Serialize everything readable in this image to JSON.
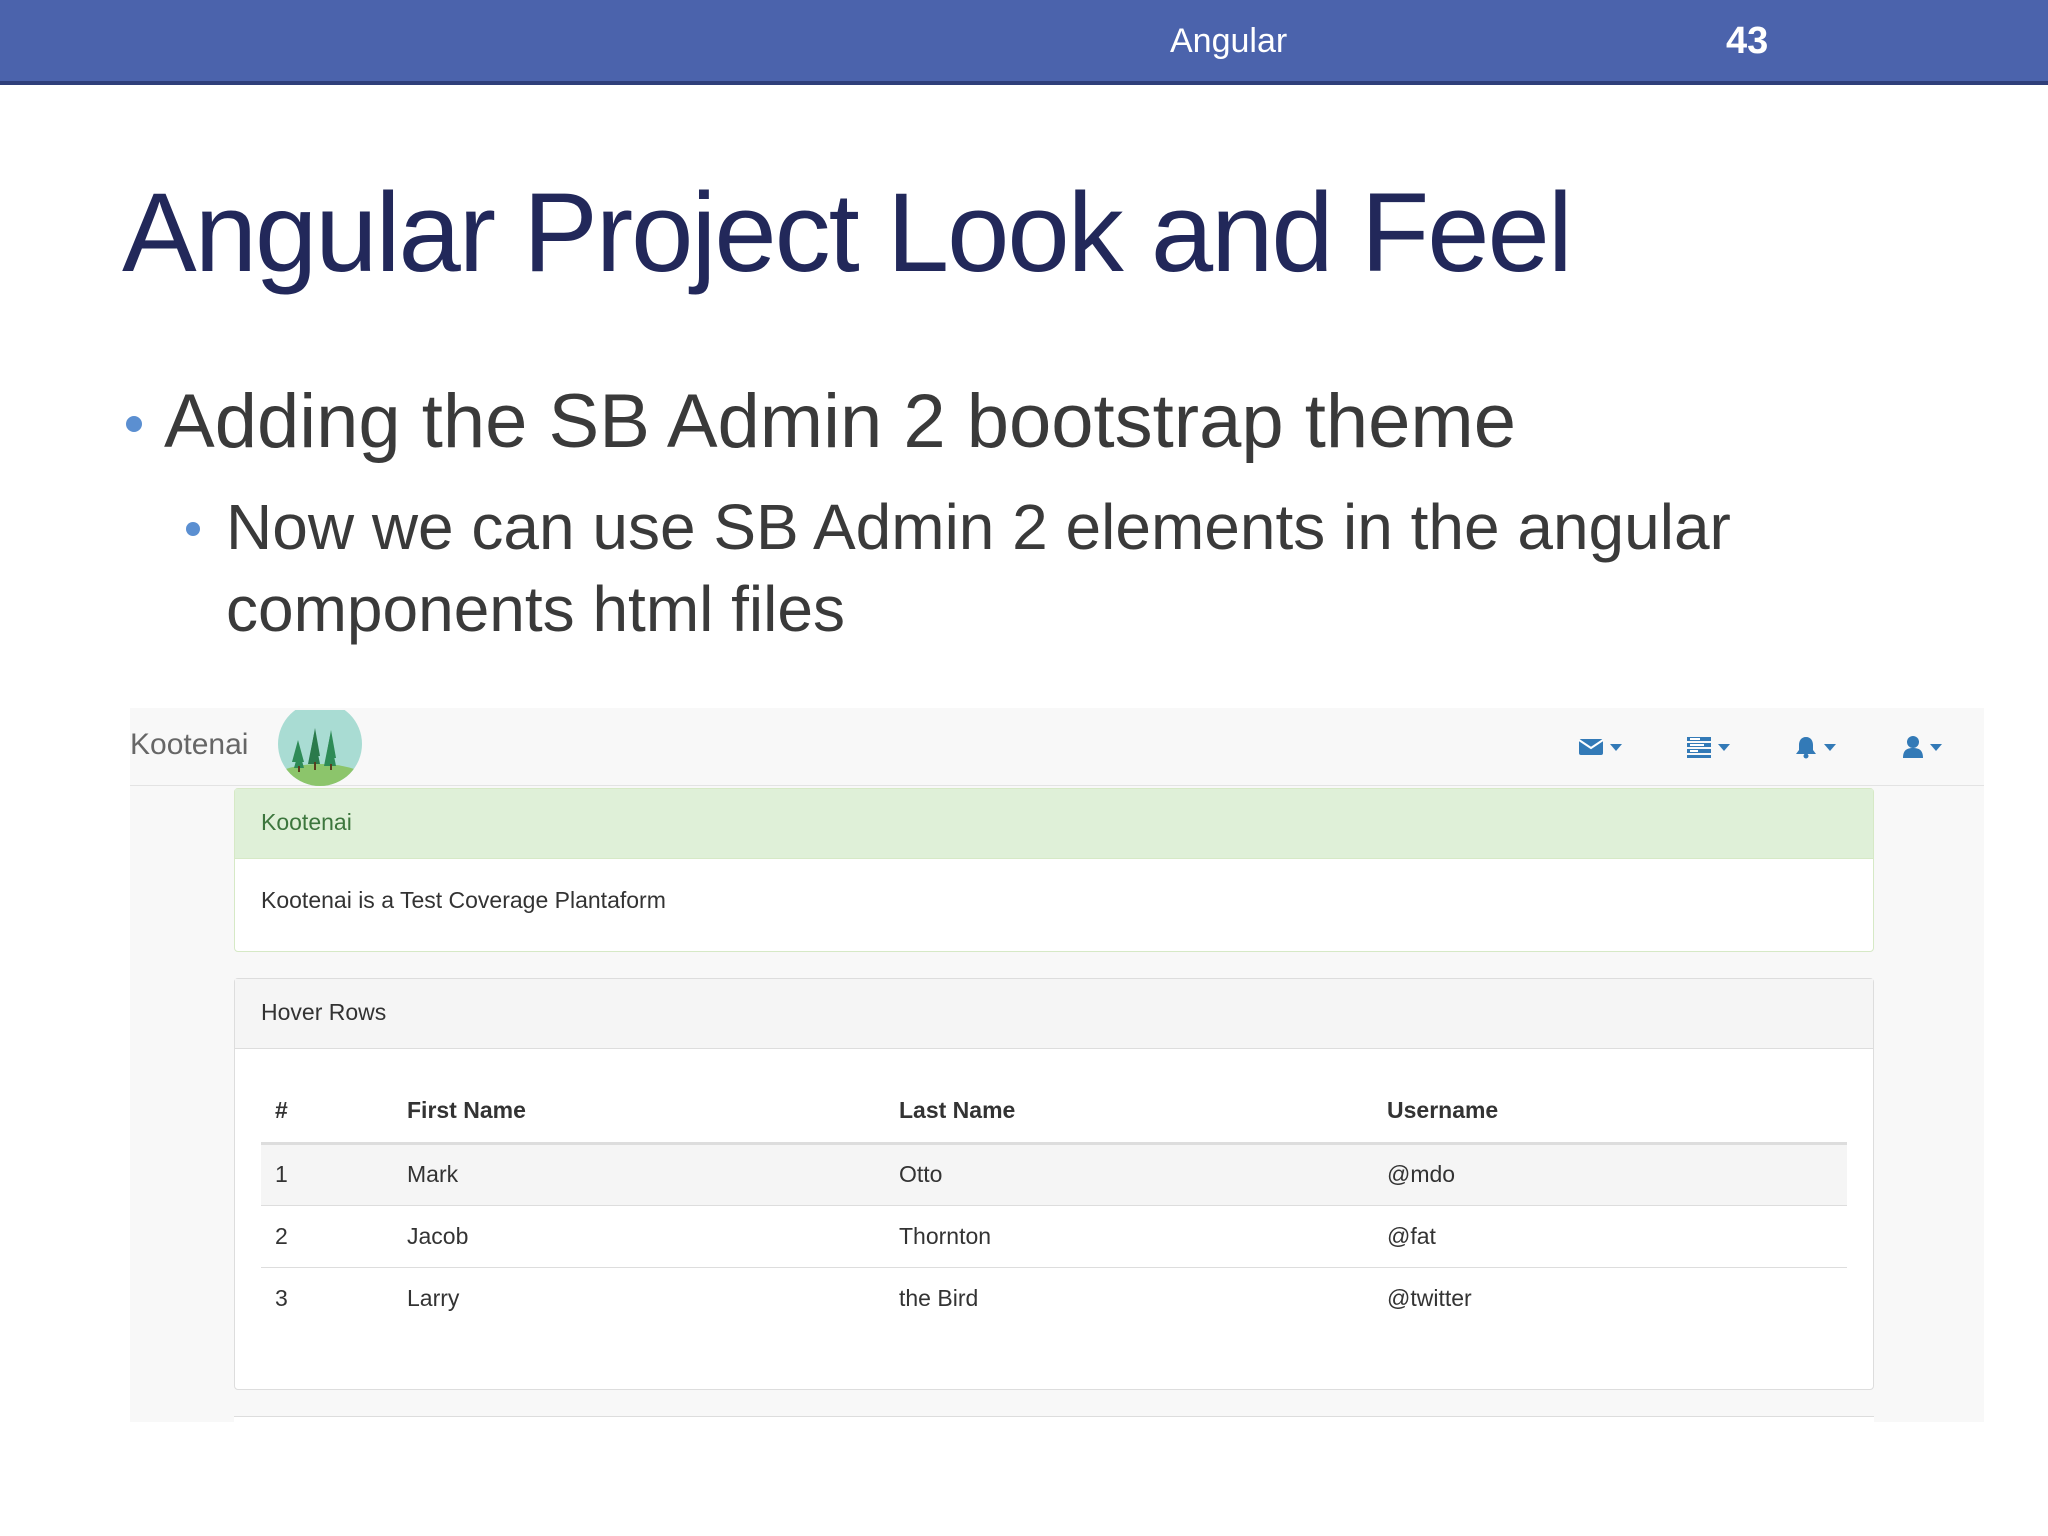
{
  "slide": {
    "section": "Angular",
    "page_number": "43",
    "title": "Angular Project Look and Feel",
    "bullet_1": "Adding the SB Admin 2 bootstrap theme",
    "bullet_2": "Now we can use SB Admin 2 elements in the angular components html files"
  },
  "app": {
    "brand": "Kootenai",
    "nav_icons": [
      "envelope-icon",
      "tasks-icon",
      "bell-icon",
      "user-icon"
    ]
  },
  "success_panel": {
    "heading": "Kootenai",
    "body": "Kootenai is a Test Coverage Plantaform"
  },
  "hover_panel": {
    "heading": "Hover Rows",
    "columns": [
      "#",
      "First Name",
      "Last Name",
      "Username"
    ],
    "rows": [
      [
        "1",
        "Mark",
        "Otto",
        "@mdo"
      ],
      [
        "2",
        "Jacob",
        "Thornton",
        "@fat"
      ],
      [
        "3",
        "Larry",
        "the Bird",
        "@twitter"
      ]
    ]
  },
  "colors": {
    "slide_header": "#4b63ac",
    "title": "#22285a",
    "bullet": "#5b8fd1",
    "link_blue": "#337ab7",
    "success_bg": "#dff0d8",
    "success_text": "#3c763d"
  }
}
